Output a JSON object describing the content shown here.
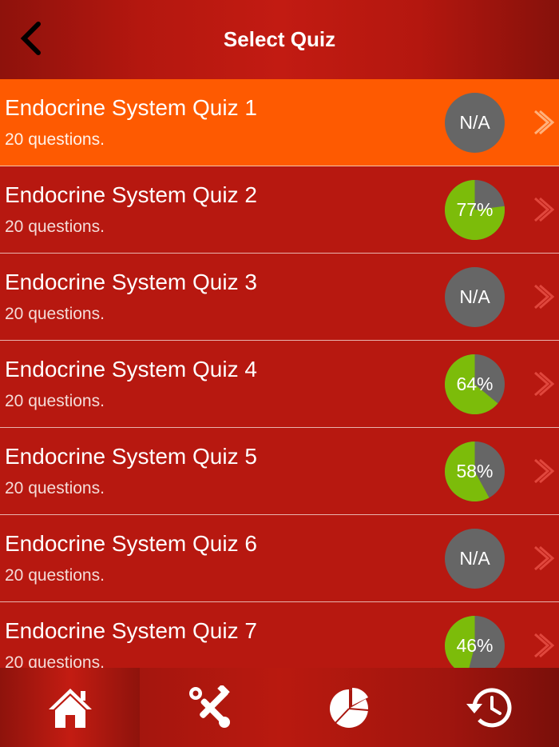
{
  "header": {
    "title": "Select Quiz",
    "back_icon": "chevron-left-icon"
  },
  "quizzes": [
    {
      "name": "Endocrine System Quiz 1",
      "questions": "20 questions.",
      "score_label": "N/A",
      "score": null,
      "selected": true
    },
    {
      "name": "Endocrine System Quiz 2",
      "questions": "20 questions.",
      "score_label": "77%",
      "score": 77,
      "selected": false
    },
    {
      "name": "Endocrine System Quiz 3",
      "questions": "20 questions.",
      "score_label": "N/A",
      "score": null,
      "selected": false
    },
    {
      "name": "Endocrine System Quiz 4",
      "questions": "20 questions.",
      "score_label": "64%",
      "score": 64,
      "selected": false
    },
    {
      "name": "Endocrine System Quiz 5",
      "questions": "20 questions.",
      "score_label": "58%",
      "score": 58,
      "selected": false
    },
    {
      "name": "Endocrine System Quiz 6",
      "questions": "20 questions.",
      "score_label": "N/A",
      "score": null,
      "selected": false
    },
    {
      "name": "Endocrine System Quiz 7",
      "questions": "20 questions.",
      "score_label": "46%",
      "score": 46,
      "selected": false
    }
  ],
  "tabbar": {
    "tabs": [
      {
        "icon": "home-icon",
        "active": true
      },
      {
        "icon": "tools-icon",
        "active": false
      },
      {
        "icon": "pie-chart-icon",
        "active": false
      },
      {
        "icon": "history-icon",
        "active": false
      }
    ]
  },
  "colors": {
    "background": "#b71810",
    "selected_row": "#fe5a01",
    "score_correct": "#7cbc0a",
    "score_remaining": "#666666"
  }
}
